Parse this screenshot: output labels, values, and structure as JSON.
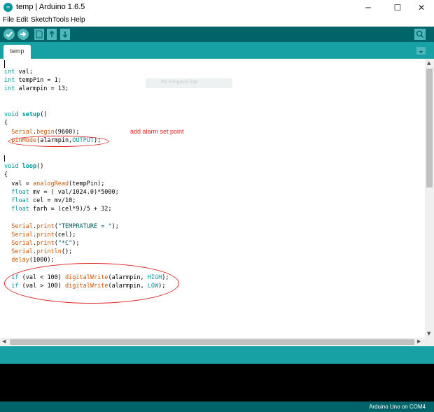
{
  "window": {
    "title": "temp | Arduino 1.6.5",
    "app_icon": "arduino-logo",
    "controls": {
      "minimize": "─",
      "maximize": "☐",
      "close": "✕"
    }
  },
  "menu": [
    "File",
    "Edit",
    "Sketch",
    "Tools",
    "Help"
  ],
  "toolbar": {
    "buttons": [
      "verify-icon",
      "upload-icon",
      "new-icon",
      "open-icon",
      "save-icon"
    ],
    "right": "serial-monitor-icon"
  },
  "tabs": [
    {
      "label": "temp"
    }
  ],
  "editor": {
    "annotation": "add alarm set point",
    "tooltip": "Pa rumgacie kap"
  },
  "status": {
    "board": "Arduino Uno on COM4"
  },
  "colors": {
    "teal_dark": "#006468",
    "teal": "#17a1a5",
    "keyword": "#00979c",
    "function": "#d35400",
    "annotation": "#e8281a"
  }
}
